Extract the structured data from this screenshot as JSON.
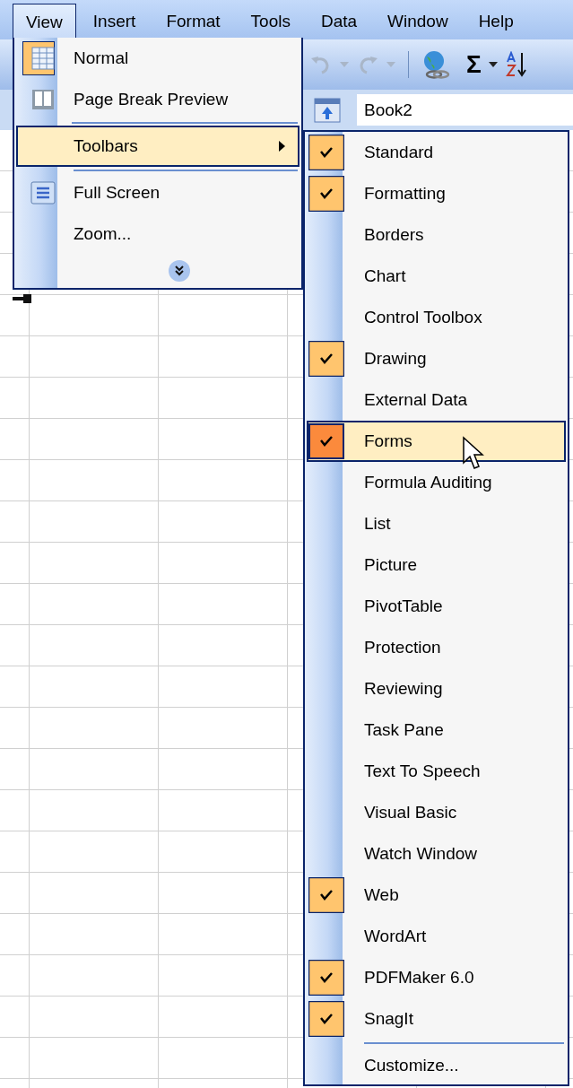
{
  "menubar": [
    {
      "label": "View",
      "selected": true
    },
    {
      "label": "Insert",
      "selected": false
    },
    {
      "label": "Format",
      "selected": false
    },
    {
      "label": "Tools",
      "selected": false
    },
    {
      "label": "Data",
      "selected": false
    },
    {
      "label": "Window",
      "selected": false
    },
    {
      "label": "Help",
      "selected": false
    }
  ],
  "toolbar": {
    "sum_symbol": "Σ"
  },
  "name_box": {
    "value": "Book2"
  },
  "view_menu": [
    {
      "label": "Normal",
      "kind": "item",
      "checked": true,
      "selected": false,
      "separator": false
    },
    {
      "label": "Page Break Preview",
      "kind": "item",
      "checked": false,
      "selected": false,
      "separator": false
    },
    {
      "label": "Toolbars",
      "kind": "submenu",
      "checked": false,
      "selected": true,
      "separator": true
    },
    {
      "label": "Full Screen",
      "kind": "item",
      "checked": false,
      "selected": false,
      "separator": true
    },
    {
      "label": "Zoom...",
      "kind": "item",
      "checked": false,
      "selected": false,
      "separator": false
    }
  ],
  "toolbars_menu": [
    {
      "label": "Standard",
      "checked": true,
      "selected": false,
      "separator": false
    },
    {
      "label": "Formatting",
      "checked": true,
      "selected": false,
      "separator": false
    },
    {
      "label": "Borders",
      "checked": false,
      "selected": false,
      "separator": false
    },
    {
      "label": "Chart",
      "checked": false,
      "selected": false,
      "separator": false
    },
    {
      "label": "Control Toolbox",
      "checked": false,
      "selected": false,
      "separator": false
    },
    {
      "label": "Drawing",
      "checked": true,
      "selected": false,
      "separator": false
    },
    {
      "label": "External Data",
      "checked": false,
      "selected": false,
      "separator": false
    },
    {
      "label": "Forms",
      "checked": true,
      "selected": true,
      "separator": false
    },
    {
      "label": "Formula Auditing",
      "checked": false,
      "selected": false,
      "separator": false
    },
    {
      "label": "List",
      "checked": false,
      "selected": false,
      "separator": false
    },
    {
      "label": "Picture",
      "checked": false,
      "selected": false,
      "separator": false
    },
    {
      "label": "PivotTable",
      "checked": false,
      "selected": false,
      "separator": false
    },
    {
      "label": "Protection",
      "checked": false,
      "selected": false,
      "separator": false
    },
    {
      "label": "Reviewing",
      "checked": false,
      "selected": false,
      "separator": false
    },
    {
      "label": "Task Pane",
      "checked": false,
      "selected": false,
      "separator": false
    },
    {
      "label": "Text To Speech",
      "checked": false,
      "selected": false,
      "separator": false
    },
    {
      "label": "Visual Basic",
      "checked": false,
      "selected": false,
      "separator": false
    },
    {
      "label": "Watch Window",
      "checked": false,
      "selected": false,
      "separator": false
    },
    {
      "label": "Web",
      "checked": true,
      "selected": false,
      "separator": false
    },
    {
      "label": "WordArt",
      "checked": false,
      "selected": false,
      "separator": false
    },
    {
      "label": "PDFMaker 6.0",
      "checked": true,
      "selected": false,
      "separator": false
    },
    {
      "label": "SnagIt",
      "checked": true,
      "selected": false,
      "separator": false
    },
    {
      "label": "Customize...",
      "checked": false,
      "selected": false,
      "separator": true
    }
  ]
}
